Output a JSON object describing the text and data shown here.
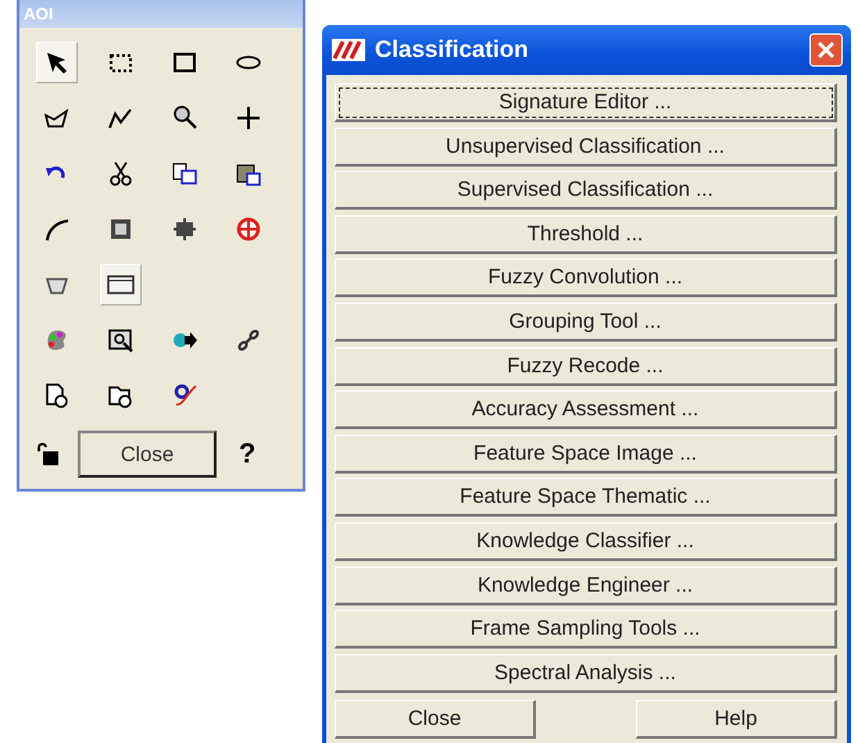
{
  "aoi_window": {
    "title": "AOI",
    "tool_rows": [
      [
        {
          "selected": true
        },
        {
          "selected": false
        },
        {
          "selected": false
        },
        {
          "selected": false
        }
      ],
      [
        {
          "selected": false
        },
        {
          "selected": false
        },
        {
          "selected": false
        },
        {
          "selected": false
        }
      ],
      [
        {
          "selected": false
        },
        {
          "selected": false
        },
        {
          "selected": false
        },
        {
          "selected": false
        }
      ],
      [
        {
          "selected": false
        },
        {
          "selected": false
        },
        {
          "selected": false
        },
        {
          "selected": false
        }
      ],
      [
        {
          "selected": false
        },
        {
          "selected": true
        }
      ],
      [
        {
          "selected": false
        },
        {
          "selected": false
        },
        {
          "selected": false
        },
        {
          "selected": false
        }
      ],
      [
        {
          "selected": false
        },
        {
          "selected": false
        },
        {
          "selected": false
        }
      ]
    ],
    "close_button": "Close",
    "help_button": "?"
  },
  "classification_window": {
    "title": "Classification",
    "buttons": [
      {
        "label": "Signature Editor ...",
        "focused": true
      },
      {
        "label": "Unsupervised Classification ...",
        "focused": false
      },
      {
        "label": "Supervised Classification ...",
        "focused": false
      },
      {
        "label": "Threshold ...",
        "focused": false
      },
      {
        "label": "Fuzzy Convolution ...",
        "focused": false
      },
      {
        "label": "Grouping Tool ...",
        "focused": false
      },
      {
        "label": "Fuzzy Recode ...",
        "focused": false
      },
      {
        "label": "Accuracy Assessment ...",
        "focused": false
      },
      {
        "label": "Feature Space Image ...",
        "focused": false
      },
      {
        "label": "Feature Space Thematic ...",
        "focused": false
      },
      {
        "label": "Knowledge Classifier ...",
        "focused": false
      },
      {
        "label": "Knowledge Engineer ...",
        "focused": false
      },
      {
        "label": "Frame Sampling Tools ...",
        "focused": false
      },
      {
        "label": "Spectral Analysis ...",
        "focused": false
      }
    ],
    "footer_buttons": [
      "Close",
      "Help"
    ]
  }
}
